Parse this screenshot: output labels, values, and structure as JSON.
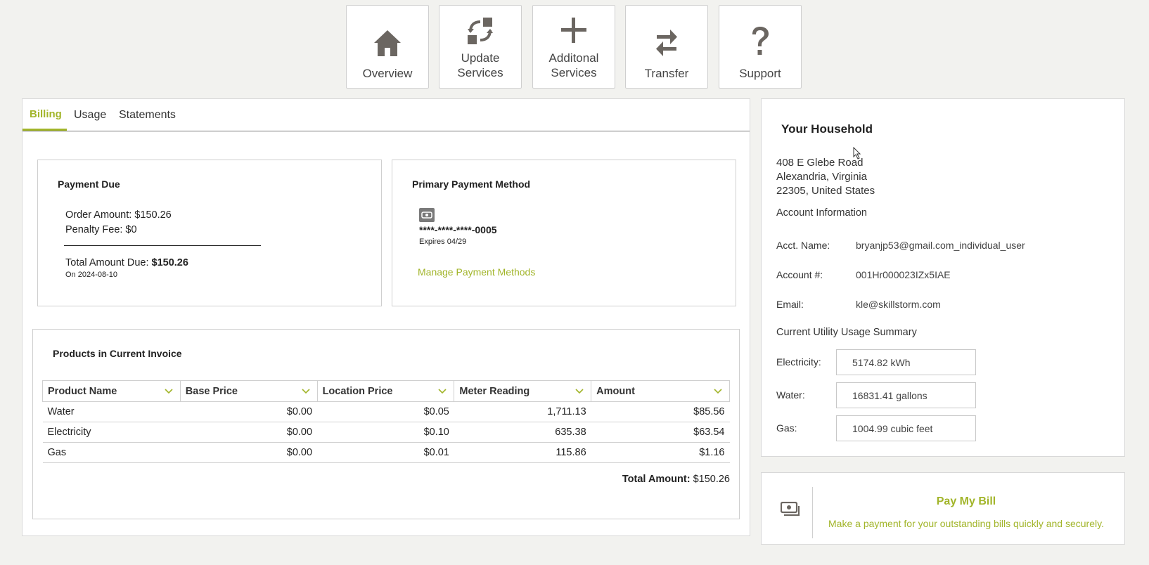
{
  "nav": {
    "overview": "Overview",
    "update_line1": "Update",
    "update_line2": "Services",
    "additional_line1": "Additonal",
    "additional_line2": "Services",
    "transfer": "Transfer",
    "support": "Support"
  },
  "tabs": {
    "billing": "Billing",
    "usage": "Usage",
    "statements": "Statements"
  },
  "payment_due": {
    "title": "Payment Due",
    "order_amount": "Order Amount: $150.26",
    "penalty_fee": "Penalty Fee: $0",
    "total_label": "Total Amount Due: ",
    "total_value": "$150.26",
    "due_date": "On 2024-08-10"
  },
  "payment_method": {
    "title": "Primary Payment Method",
    "card_number": "****-****-****-0005",
    "expires": "Expires 04/29",
    "manage_link": "Manage Payment Methods"
  },
  "invoice": {
    "title": "Products in Current Invoice",
    "columns": [
      "Product Name",
      "Base Price",
      "Location Price",
      "Meter Reading",
      "Amount"
    ],
    "rows": [
      [
        "Water",
        "$0.00",
        "$0.05",
        "1,711.13",
        "$85.56"
      ],
      [
        "Electricity",
        "$0.00",
        "$0.10",
        "635.38",
        "$63.54"
      ],
      [
        "Gas",
        "$0.00",
        "$0.01",
        "115.86",
        "$1.16"
      ]
    ],
    "total_label": "Total Amount:",
    "total_value": " $150.26"
  },
  "household": {
    "title": "Your Household",
    "address_line1": "408 E Glebe Road",
    "address_line2": "Alexandria, Virginia",
    "address_line3": "22305, United States",
    "account_info_title": "Account Information",
    "acct_name_label": "Acct. Name:",
    "acct_name_value": "bryanjp53@gmail.com_individual_user",
    "account_num_label": "Account #:",
    "account_num_value": "001Hr000023IZx5IAE",
    "email_label": "Email:",
    "email_value": "kle@skillstorm.com",
    "usage_summary_title": "Current Utility Usage Summary",
    "electricity_label": "Electricity:",
    "electricity_value": "5174.82 kWh",
    "water_label": "Water:",
    "water_value": "16831.41 gallons",
    "gas_label": "Gas:",
    "gas_value": "1004.99 cubic feet"
  },
  "pay_bill": {
    "title": "Pay My Bill",
    "description": "Make a payment for your outstanding bills quickly and securely."
  },
  "colors": {
    "accent": "#a2b52a",
    "icon": "#6b6661"
  }
}
